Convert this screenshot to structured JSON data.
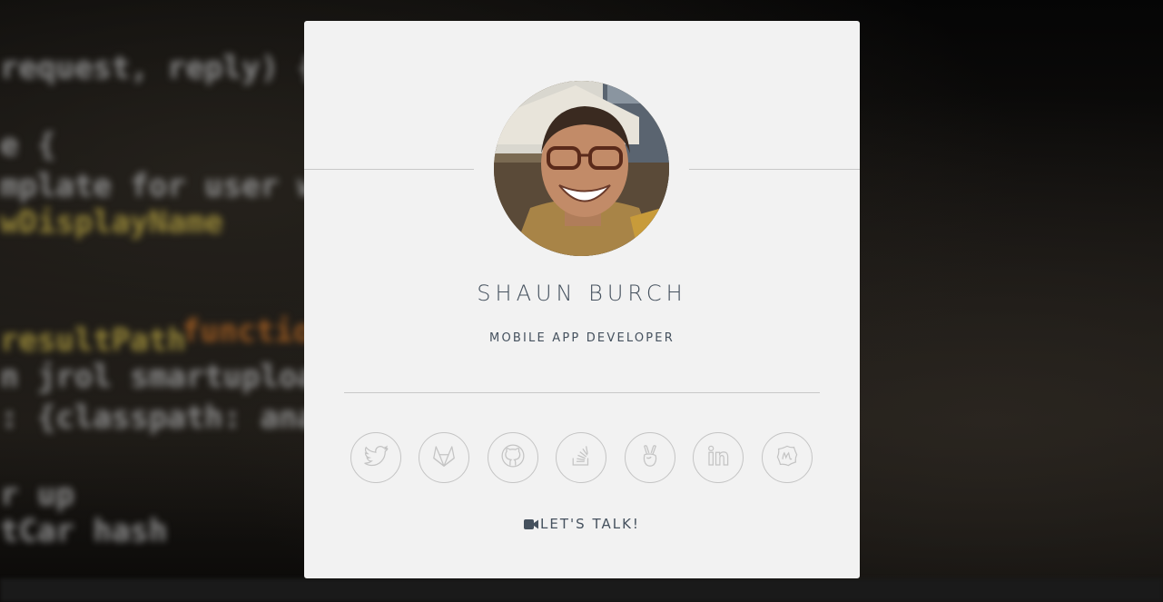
{
  "profile": {
    "name": "SHAUN BURCH",
    "title": "MOBILE APP DEVELOPER"
  },
  "socials": [
    {
      "name": "twitter",
      "icon": "twitter-icon"
    },
    {
      "name": "gitlab",
      "icon": "gitlab-icon"
    },
    {
      "name": "github",
      "icon": "github-icon"
    },
    {
      "name": "stackoverflow",
      "icon": "stackoverflow-icon"
    },
    {
      "name": "angellist",
      "icon": "angellist-icon"
    },
    {
      "name": "linkedin",
      "icon": "linkedin-icon"
    },
    {
      "name": "meetup",
      "icon": "meetup-icon"
    }
  ],
  "cta": {
    "label": "LET'S TALK!",
    "icon": "video-camera-icon"
  },
  "colors": {
    "card": "#f2f2f2",
    "text": "#45515e",
    "icon_stroke": "#c4c4c4"
  }
}
